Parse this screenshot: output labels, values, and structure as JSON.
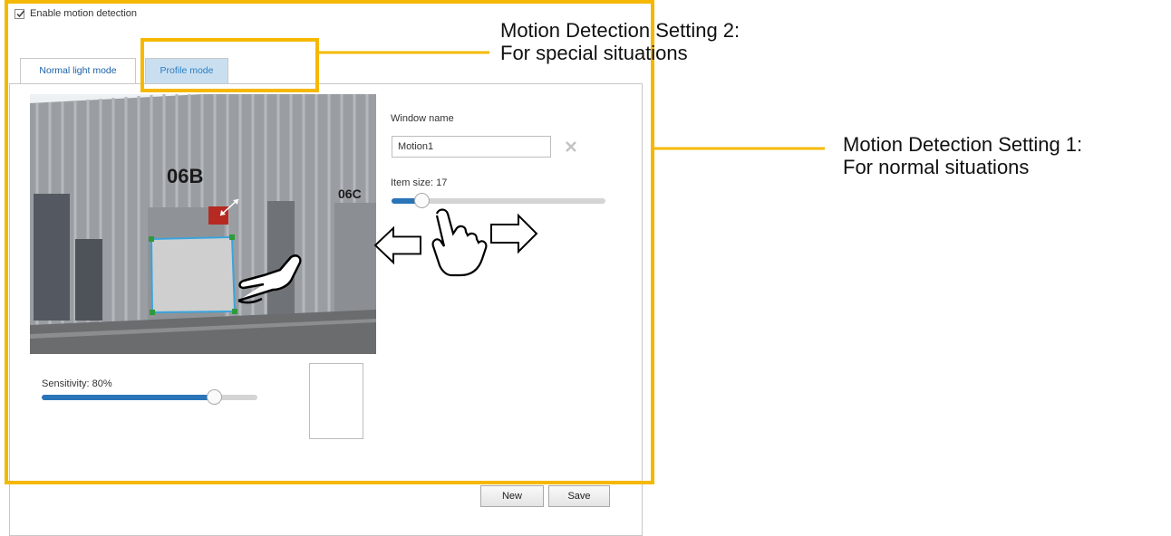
{
  "checkbox": {
    "label": "Enable motion detection",
    "checked": true
  },
  "tabs": [
    {
      "label": "Normal light mode",
      "active": true
    },
    {
      "label": "Profile mode",
      "active": false
    }
  ],
  "window_name": {
    "label": "Window name",
    "value": "Motion1"
  },
  "item_size": {
    "label": "Item size: 17",
    "value": 17
  },
  "sensitivity": {
    "label": "Sensitivity: 80%",
    "value_percent": 80
  },
  "buttons": {
    "new_label": "New",
    "save_label": "Save"
  },
  "camera_scene": {
    "building_labels": [
      "06B",
      "06C"
    ]
  },
  "callouts": {
    "setting1": {
      "line1": "Motion Detection Setting 1:",
      "line2": "For normal situations"
    },
    "setting2": {
      "line1": "Motion Detection Setting 2:",
      "line2": "For special situations"
    }
  },
  "colors": {
    "callout_outline": "#f5b800",
    "accent_blue": "#2a74b8",
    "tab_active_bg": "#c9dff0"
  },
  "icons": [
    "checkbox-check-icon",
    "delete-window-icon",
    "pointing-hand-icon",
    "tap-hand-icon",
    "left-arrow-icon",
    "right-arrow-icon"
  ]
}
